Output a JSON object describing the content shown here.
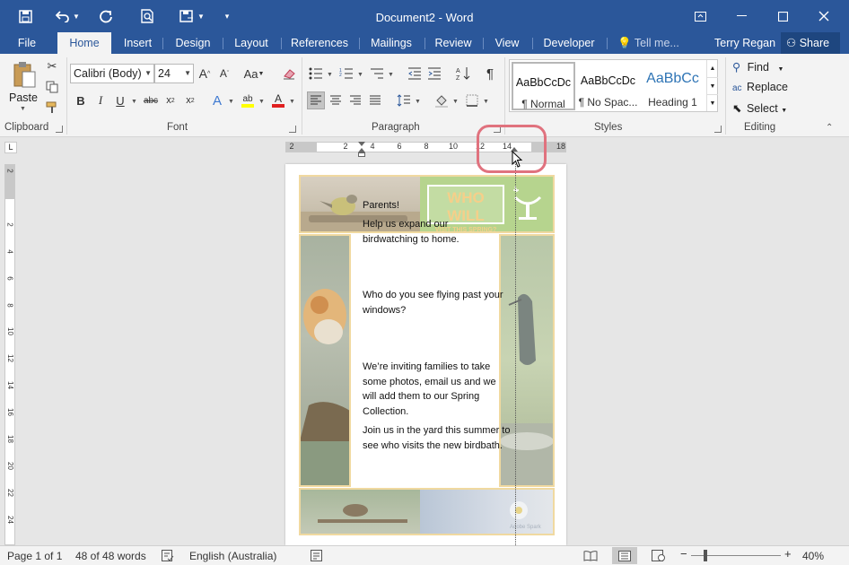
{
  "window": {
    "title": "Document2 - Word"
  },
  "quick_access": {
    "save_icon": "save-icon",
    "undo_icon": "undo-icon",
    "redo_icon": "redo-icon",
    "print_preview_icon": "print-preview-icon",
    "touch_mode_icon": "touch-mode-icon",
    "customize_icon": "customize-qat-icon"
  },
  "tabs": [
    {
      "label": "File"
    },
    {
      "label": "Home"
    },
    {
      "label": "Insert"
    },
    {
      "label": "Design"
    },
    {
      "label": "Layout"
    },
    {
      "label": "References"
    },
    {
      "label": "Mailings"
    },
    {
      "label": "Review"
    },
    {
      "label": "View"
    },
    {
      "label": "Developer"
    },
    {
      "label": "Tell me..."
    }
  ],
  "active_tab": "Home",
  "user": {
    "name": "Terry Regan",
    "share_label": "Share"
  },
  "clipboard": {
    "paste_label": "Paste",
    "group_label": "Clipboard"
  },
  "font": {
    "name": "Calibri (Body)",
    "size": "24",
    "group_label": "Font"
  },
  "paragraph": {
    "group_label": "Paragraph"
  },
  "styles": {
    "group_label": "Styles",
    "items": [
      {
        "sample": "AaBbCcDc",
        "name": "¶ Normal"
      },
      {
        "sample": "AaBbCcDc",
        "name": "¶ No Spac..."
      },
      {
        "sample": "AaBbCc",
        "name": "Heading 1"
      }
    ]
  },
  "editing": {
    "find_label": "Find",
    "replace_label": "Replace",
    "select_label": "Select",
    "group_label": "Editing"
  },
  "ruler": {
    "h_numbers": [
      "2",
      "2",
      "4",
      "6",
      "8",
      "10",
      "12",
      "14",
      "18"
    ],
    "v_numbers": [
      "2",
      "2",
      "4",
      "6",
      "8",
      "10",
      "12",
      "14",
      "16",
      "18",
      "20",
      "22",
      "24"
    ]
  },
  "document": {
    "banner_line1": "WHO WILL",
    "banner_line2": "VISIT THIS SPRING?",
    "paragraphs": [
      "Parents!",
      "Help us expand our birdwatching to home.",
      "Who do you see flying past your windows?",
      "We’re inviting families to take some photos, email us and we will add them to our Spring Collection.",
      "Join us in the yard this summer to see who visits the new birdbath."
    ],
    "watermark": "Adobe Spark"
  },
  "status": {
    "page": "Page 1 of 1",
    "words": "48 of 48 words",
    "language": "English (Australia)",
    "zoom": "40%"
  },
  "colors": {
    "accent": "#2b579a",
    "banner_green": "#a9cf73",
    "banner_text": "#f5d08a",
    "frame": "#f0d9a0",
    "callout": "#e0727e"
  }
}
